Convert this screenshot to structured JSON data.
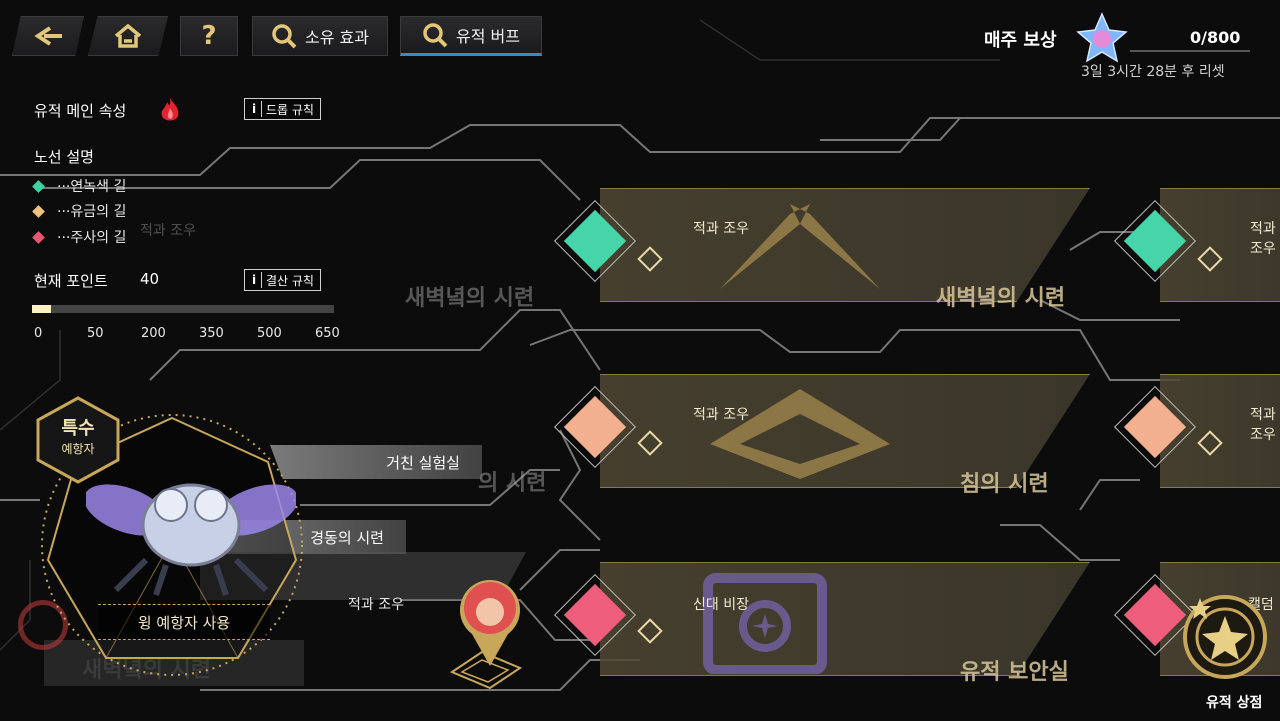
{
  "header": {
    "back_label": "",
    "home_label": "",
    "help_label": "?",
    "tab_effects": "소유 효과",
    "tab_buffs": "유적 버프",
    "weekly_reward_label": "매주 보상",
    "weekly_reward_count": "0/800",
    "reset_text": "3일 3시간 28분 후 리셋"
  },
  "info": {
    "main_attribute_label": "유적 메인 속성",
    "drop_rules_label": "드롭 규칙",
    "route_desc_label": "노선 설명",
    "routes": [
      {
        "label": "···연녹색 길",
        "color": "#3fd3a4"
      },
      {
        "label": "···유금의 길",
        "color": "#f0c27a"
      },
      {
        "label": "···주사의 길",
        "color": "#e8566f"
      }
    ],
    "current_points_label": "현재 포인트",
    "current_points_value": "40",
    "settle_rules_label": "결산 규칙",
    "progress_fraction": 0.0615,
    "thresholds": [
      "0",
      "50",
      "200",
      "350",
      "500",
      "650"
    ]
  },
  "nodes": [
    {
      "sub": "적과 조우",
      "big": "새벽녘의 시련",
      "gem_color": "#45d5a8"
    },
    {
      "sub": "적과 조우",
      "big": "",
      "gem_color": "#45d5a8"
    },
    {
      "sub": "적과 조우",
      "big": "침의 시련",
      "gem_color": "#f2b08f"
    },
    {
      "sub": "적과 조우",
      "big": "",
      "gem_color": "#f2b08f"
    },
    {
      "sub": "신대 비장",
      "big": "유적 보안실",
      "gem_color": "#ee5e7c"
    },
    {
      "sub": "캘덤",
      "big": "",
      "gem_color": "#ee5e7c"
    }
  ],
  "background_labels": {
    "dawn_trial": "새벽녘의 시련",
    "trial_short": "의 시련",
    "encounter_ghost": "적과 조우",
    "rough_lab": "거친 실험실",
    "alert_trial": "경동의 시련",
    "encounter_left": "적과 조우",
    "dawn_ghost_bottom": "새벽녘의 시련"
  },
  "character": {
    "badge_title": "특수",
    "badge_sub": "예항자",
    "use_button": "윙 예항자 사용"
  },
  "shop": {
    "label": "유적 상점"
  },
  "colors": {
    "accent": "#2b8fd6",
    "gold": "#c9a75a",
    "plate": "#4e4733"
  }
}
